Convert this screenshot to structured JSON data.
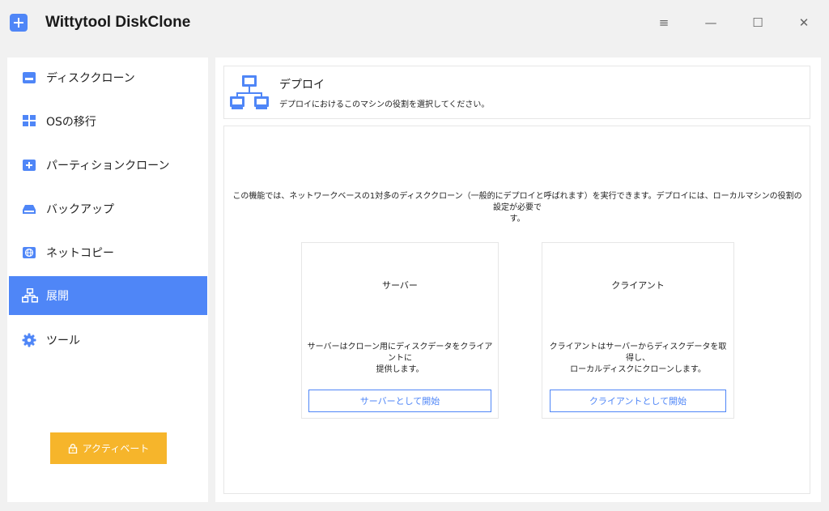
{
  "app": {
    "title": "Wittytool DiskClone",
    "logo_icon": "plus-square-icon",
    "accent": "#4f86f7"
  },
  "window_controls": {
    "menu": "≡",
    "minimize": "—",
    "maximize": "☐",
    "close": "✕"
  },
  "sidebar": {
    "items": [
      {
        "label": "ディスククローン",
        "icon": "disk-icon"
      },
      {
        "label": "OSの移行",
        "icon": "windows-icon"
      },
      {
        "label": "パーティションクローン",
        "icon": "partition-icon"
      },
      {
        "label": "バックアップ",
        "icon": "backup-drive-icon"
      },
      {
        "label": "ネットコピー",
        "icon": "globe-icon"
      },
      {
        "label": "展開",
        "icon": "network-icon",
        "active": true
      },
      {
        "label": "ツール",
        "icon": "gear-icon"
      }
    ],
    "activate_label": "アクティベート",
    "activate_color": "#f6b52b"
  },
  "main": {
    "header": {
      "title": "デプロイ",
      "subtitle": "デプロイにおけるこのマシンの役割を選択してください。"
    },
    "description_line1": "この機能では、ネットワークベースの1対多のディスククローン（一般的にデプロイと呼ばれます）を実行できます。デプロイには、ローカルマシンの役割の設定が必要で",
    "description_line2": "す。",
    "server_card": {
      "title": "サーバー",
      "desc_line1": "サーバーはクローン用にディスクデータをクライアントに",
      "desc_line2": "提供します。",
      "button": "サーバーとして開始"
    },
    "client_card": {
      "title": "クライアント",
      "desc_line1": "クライアントはサーバーからディスクデータを取得し、",
      "desc_line2": "ローカルディスクにクローンします。",
      "button": "クライアントとして開始"
    }
  }
}
